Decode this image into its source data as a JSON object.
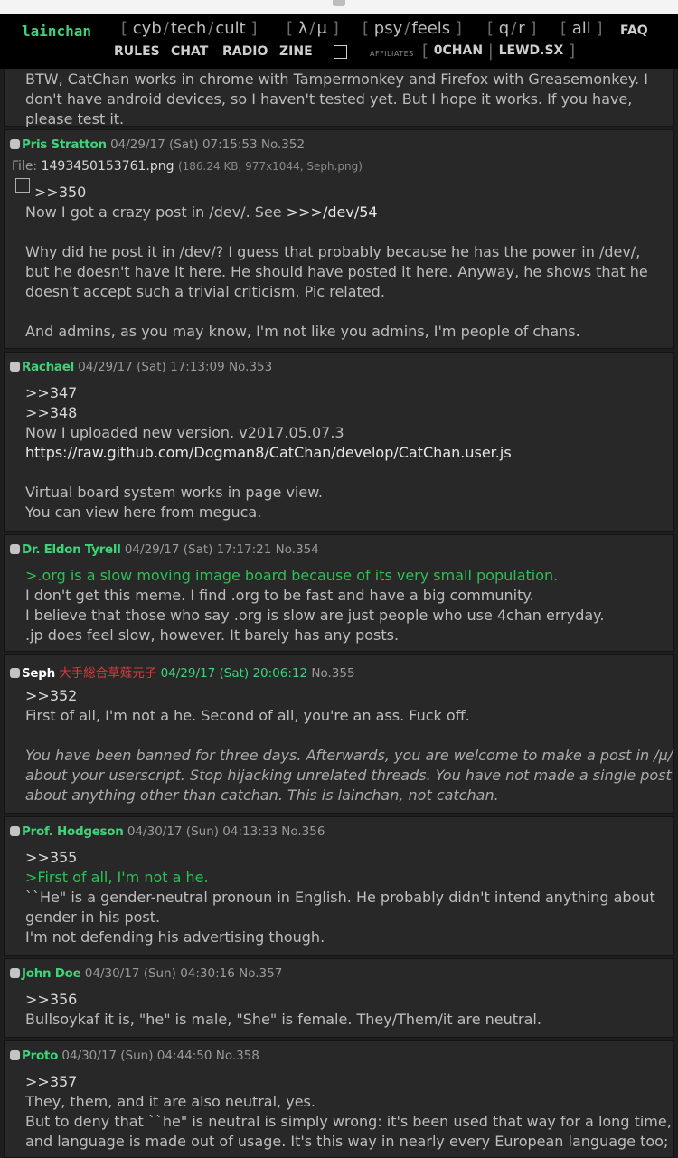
{
  "nav": {
    "logo": "lainchan",
    "boards1": [
      "cyb",
      "tech",
      "cult"
    ],
    "boards2": [
      "λ",
      "μ"
    ],
    "boards3": [
      "psy",
      "feels"
    ],
    "boards4": [
      "q",
      "r"
    ],
    "boards5": [
      "all"
    ],
    "faq": "FAQ",
    "row2": [
      "RULES",
      "CHAT",
      "RADIO",
      "ZINE"
    ],
    "affiliates_label": "AFFILIATES",
    "affiliates": [
      "0CHAN",
      "LEWD.SX"
    ]
  },
  "posts": [
    {
      "id": "351",
      "lines": [
        "BTW, CatChan works in chrome with Tampermonkey and Firefox with Greasemonkey. I",
        "don't have android devices, so I haven't tested yet. But I hope it works. If you have,",
        "please test it."
      ]
    },
    {
      "id": "352",
      "name": "Pris Stratton",
      "date": "04/29/17 (Sat) 07:15:53",
      "no": "No.352",
      "file_label": "File:",
      "file_name": "1493450153761.png",
      "file_meta": "(186.24 KB, 977x1044, Seph.png)",
      "ref": ">>350",
      "lines": [
        "Now I got a crazy post in /dev/. See ",
        "Why did he post it in /dev/? I guess that probably because he has the power in /dev/,",
        "but he doesn't have it here. He should have posted it here. Anyway, he shows that he",
        "doesn't accept such a trivial criticism. Pic related.",
        "And admins, as you may know, I'm not like you admins, I'm people of chans."
      ],
      "crosslink": ">>>/dev/54"
    },
    {
      "id": "353",
      "name": "Rachael",
      "date": "04/29/17 (Sat) 17:13:09",
      "no": "No.353",
      "refs": [
        ">>347",
        ">>348"
      ],
      "lines": [
        "Now I uploaded new version. v2017.05.07.3",
        "Virtual board system works in page view.",
        "You can view here from meguca."
      ],
      "url": "https://raw.github.com/Dogman8/CatChan/develop/CatChan.user.js"
    },
    {
      "id": "354",
      "name": "Dr. Eldon Tyrell",
      "date": "04/29/17 (Sat) 17:17:21",
      "no": "No.354",
      "quote": ">.org is a slow moving image board because of its very small population.",
      "lines": [
        "I don't get this meme. I find .org to be fast and have a big community.",
        "I believe that those who say .org is slow are just people who use 4chan erryday.",
        ".jp does feel slow, however. It barely has any posts."
      ]
    },
    {
      "id": "355",
      "name": "Seph",
      "tag": "大手総合草薙元子",
      "date": "04/29/17 (Sat) 20:06:12",
      "no": "No.355",
      "ref": ">>352",
      "lines": [
        "First of all, I'm not a he. Second of all, you're an ass. Fuck off."
      ],
      "mod_lines": [
        "You have been banned for three days. Afterwards, you are welcome to make a post in /μ/",
        "about your userscript. Stop hijacking unrelated threads. You have not made a single post",
        "about anything other than catchan. This is lainchan, not catchan."
      ]
    },
    {
      "id": "356",
      "name": "Prof. Hodgeson",
      "date": "04/30/17 (Sun) 04:13:33",
      "no": "No.356",
      "ref": ">>355",
      "quote": ">First of all, I'm not a he.",
      "lines": [
        "``He\" is a gender-neutral pronoun in English. He probably didn't intend anything about",
        "gender in his post.",
        "I'm not defending his advertising though."
      ]
    },
    {
      "id": "357",
      "name": "John Doe",
      "date": "04/30/17 (Sun) 04:30:16",
      "no": "No.357",
      "ref": ">>356",
      "lines": [
        "Bullsoykaf it is, \"he\" is male, \"She\" is female. They/Them/it are neutral."
      ]
    },
    {
      "id": "358",
      "name": "Proto",
      "date": "04/30/17 (Sun) 04:44:50",
      "no": "No.358",
      "ref": ">>357",
      "lines": [
        "They, them, and it are also neutral, yes.",
        "But to deny that ``he\" is neutral is simply wrong: it's been used that way for a long time,",
        "and language is made out of usage. It's this way in nearly every European language too;"
      ]
    }
  ]
}
